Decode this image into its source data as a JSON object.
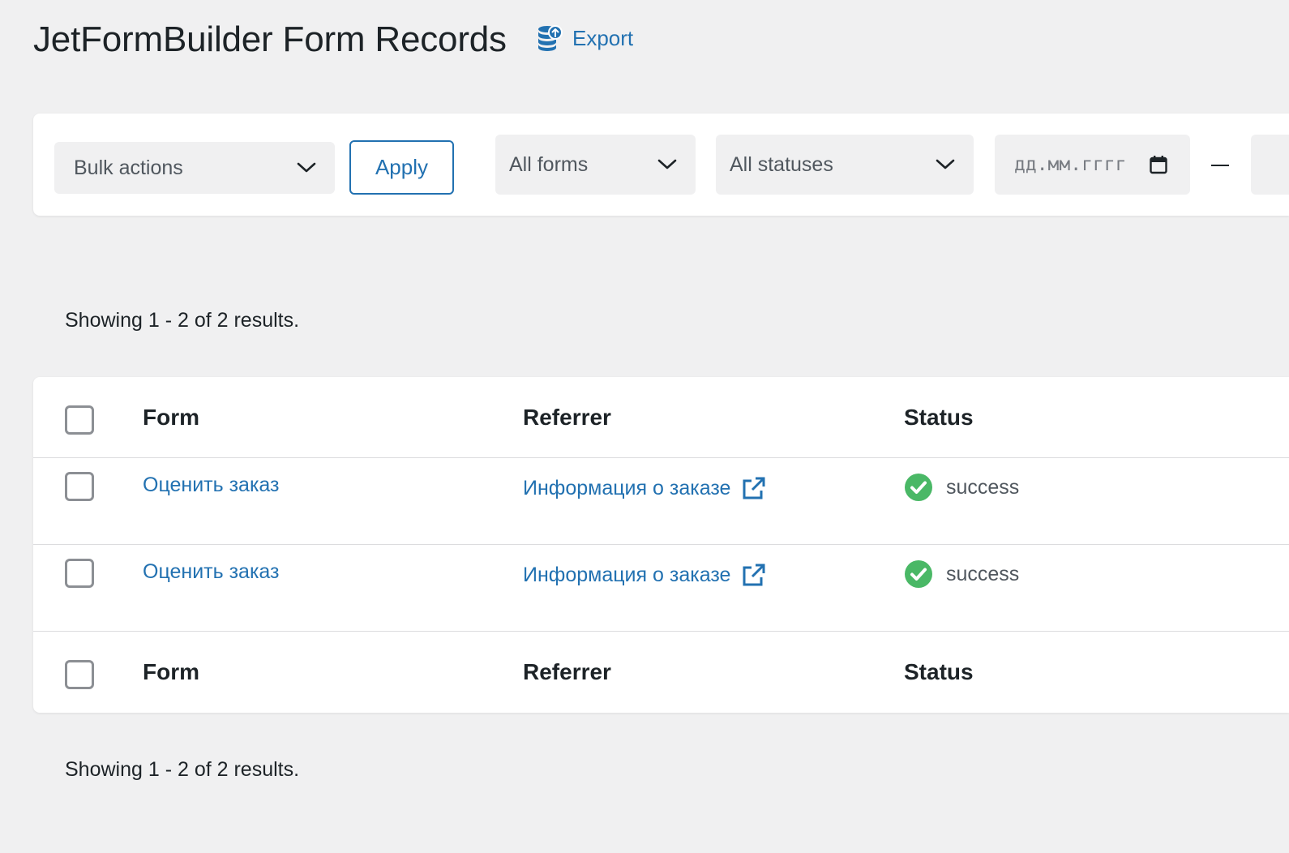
{
  "header": {
    "title": "JetFormBuilder Form Records",
    "export_label": "Export"
  },
  "filters": {
    "bulk_actions": "Bulk actions",
    "apply_label": "Apply",
    "forms": "All forms",
    "statuses": "All statuses",
    "date_placeholder": "дд.мм.гггг"
  },
  "results_text": "Showing 1 - 2 of 2 results.",
  "table": {
    "columns": [
      "Form",
      "Referrer",
      "Status"
    ],
    "rows": [
      {
        "form": "Оценить заказ",
        "referrer": "Информация о заказе",
        "status": "success"
      },
      {
        "form": "Оценить заказ",
        "referrer": "Информация о заказе",
        "status": "success"
      }
    ]
  },
  "colors": {
    "accent": "#2271b1",
    "success": "#4ab866",
    "background": "#f0f0f1"
  },
  "icons": {
    "export": "database-upload-icon",
    "dropdown": "chevron-down-icon",
    "calendar": "calendar-icon",
    "external": "external-link-icon",
    "status": "check-circle-icon"
  }
}
